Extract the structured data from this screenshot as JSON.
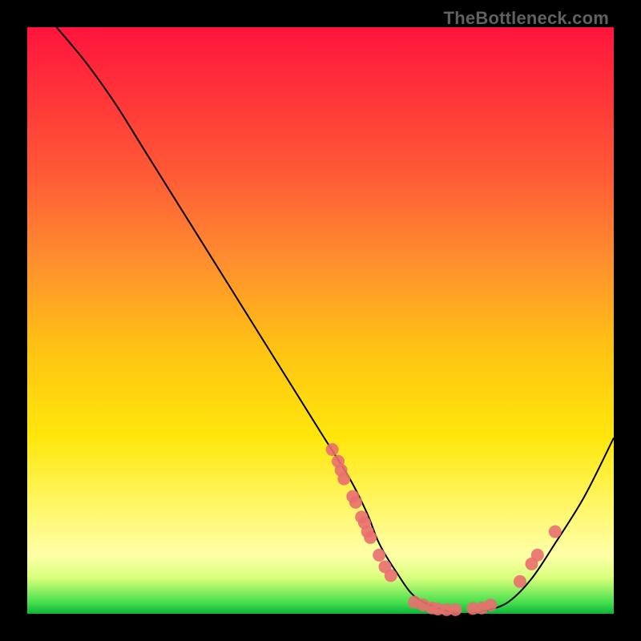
{
  "watermark": "TheBottleneck.com",
  "chart_data": {
    "type": "line",
    "title": "",
    "xlabel": "",
    "ylabel": "",
    "xlim": [
      0,
      100
    ],
    "ylim": [
      0,
      100
    ],
    "grid": false,
    "series": [
      {
        "name": "bottleneck-curve",
        "x": [
          5,
          10,
          15,
          20,
          25,
          30,
          35,
          40,
          45,
          50,
          55,
          58,
          60,
          63,
          66,
          70,
          74,
          78,
          82,
          86,
          90,
          95,
          100
        ],
        "y": [
          100,
          94,
          87,
          79,
          71,
          63,
          55,
          47,
          39,
          31,
          23,
          17,
          12,
          7,
          3,
          1,
          0,
          0.5,
          2,
          6,
          12,
          20,
          30
        ]
      }
    ],
    "markers": [
      {
        "name": "left-cluster-top",
        "x": 52,
        "y": 28
      },
      {
        "name": "left-cluster-1",
        "x": 53,
        "y": 26
      },
      {
        "name": "left-cluster-2",
        "x": 53.5,
        "y": 24.5
      },
      {
        "name": "left-cluster-3",
        "x": 54,
        "y": 23
      },
      {
        "name": "left-cluster-4",
        "x": 55.5,
        "y": 20
      },
      {
        "name": "left-cluster-5",
        "x": 56,
        "y": 19
      },
      {
        "name": "left-cluster-6",
        "x": 57,
        "y": 16.5
      },
      {
        "name": "left-cluster-7",
        "x": 57.5,
        "y": 15.5
      },
      {
        "name": "left-cluster-8",
        "x": 58,
        "y": 14
      },
      {
        "name": "left-cluster-9",
        "x": 58.5,
        "y": 13
      },
      {
        "name": "mid-1",
        "x": 60,
        "y": 10
      },
      {
        "name": "mid-2",
        "x": 61,
        "y": 8
      },
      {
        "name": "mid-3",
        "x": 62,
        "y": 6.5
      },
      {
        "name": "valley-left-1",
        "x": 66,
        "y": 2
      },
      {
        "name": "valley-left-2",
        "x": 67.5,
        "y": 1.5
      },
      {
        "name": "valley-center-1",
        "x": 69,
        "y": 1
      },
      {
        "name": "valley-center-2",
        "x": 70,
        "y": 0.8
      },
      {
        "name": "valley-center-3",
        "x": 71.5,
        "y": 0.7
      },
      {
        "name": "valley-center-4",
        "x": 73,
        "y": 0.7
      },
      {
        "name": "valley-right-1",
        "x": 76,
        "y": 0.9
      },
      {
        "name": "valley-right-2",
        "x": 77.5,
        "y": 1
      },
      {
        "name": "valley-right-3",
        "x": 79,
        "y": 1.5
      },
      {
        "name": "right-rise-1",
        "x": 84,
        "y": 5.5
      },
      {
        "name": "right-rise-2",
        "x": 86,
        "y": 8.5
      },
      {
        "name": "right-rise-3",
        "x": 87,
        "y": 10
      },
      {
        "name": "right-rise-4",
        "x": 90,
        "y": 14
      }
    ],
    "marker_color": "#e96f6f",
    "marker_radius": 8,
    "curve_color": "#000000",
    "curve_width": 2
  }
}
